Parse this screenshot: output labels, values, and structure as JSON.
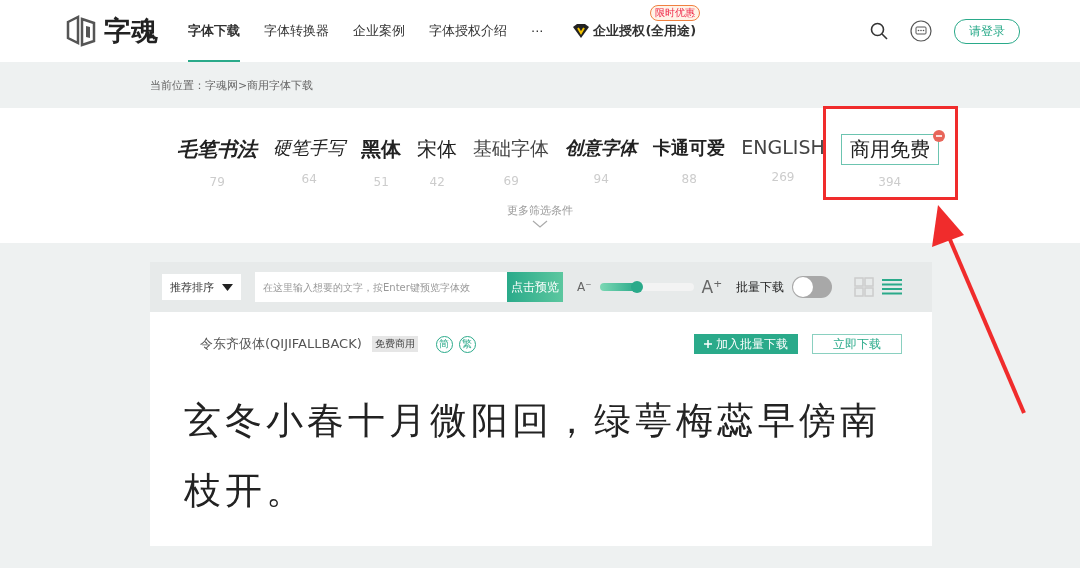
{
  "header": {
    "logo": "字魂",
    "nav": [
      {
        "label": "字体下载",
        "selected": true
      },
      {
        "label": "字体转换器",
        "selected": false
      },
      {
        "label": "企业案例",
        "selected": false
      },
      {
        "label": "字体授权介绍",
        "selected": false
      },
      {
        "label": "···",
        "selected": false
      }
    ],
    "enterprise": {
      "label": "企业授权(全用途)",
      "badge": "限时优惠"
    },
    "login": "请登录"
  },
  "breadcrumb": "当前位置：字魂网>商用字体下载",
  "categories": [
    {
      "label": "毛笔书法",
      "count": "79",
      "kind": "brush",
      "selected": false
    },
    {
      "label": "硬笔手写",
      "count": "64",
      "kind": "pen",
      "selected": false
    },
    {
      "label": "黑体",
      "count": "51",
      "kind": "bold",
      "selected": false
    },
    {
      "label": "宋体",
      "count": "42",
      "kind": "song",
      "selected": false
    },
    {
      "label": "基础字体",
      "count": "69",
      "kind": "plain",
      "selected": false
    },
    {
      "label": "创意字体",
      "count": "94",
      "kind": "creative",
      "selected": false
    },
    {
      "label": "卡通可爱",
      "count": "88",
      "kind": "cartoon",
      "selected": false
    },
    {
      "label": "ENGLISH",
      "count": "269",
      "kind": "plain",
      "selected": false
    },
    {
      "label": "商用免费",
      "count": "394",
      "kind": "song",
      "selected": true
    }
  ],
  "more_filters": "更多筛选条件",
  "toolbar": {
    "sort": "推荐排序",
    "placeholder": "在这里输入想要的文字，按Enter键预览字体效",
    "preview": "点击预览",
    "size_small": "A⁻",
    "size_large": "A⁺",
    "size_slider": {
      "level": 0.4
    },
    "batch_label": "批量下载",
    "batch_on": false
  },
  "font_item": {
    "name": "令东齐伋体(QIJIFALLBACK)",
    "tag": "免费商用",
    "variants": [
      "简",
      "繁"
    ],
    "add_batch": "加入批量下载",
    "download": "立即下载",
    "sample": "玄冬小春十月微阳回，绿萼梅蕊早傍南枝开。"
  }
}
